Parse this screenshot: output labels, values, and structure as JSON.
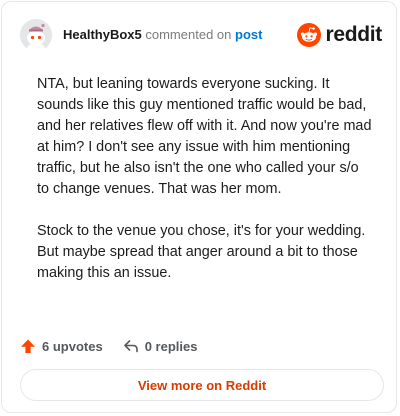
{
  "header": {
    "username": "HealthyBox5",
    "action_text": "commented on",
    "target_link": "post",
    "brand_name": "reddit",
    "brand_color": "#ff4500"
  },
  "comment": {
    "paragraphs": [
      "NTA, but leaning towards everyone sucking. It sounds like this guy mentioned traffic would be bad, and her relatives flew off with it. And now you're mad at him? I don't see any issue with him mentioning traffic, but he also isn't the one who called your s/o to change venues. That was her mom.",
      "Stock to the venue you chose, it's for your wedding. But maybe spread that anger around a bit to those making this an issue."
    ]
  },
  "actions": {
    "upvote_icon": "upvote-arrow-icon",
    "upvotes_label": "6 upvotes",
    "reply_icon": "reply-arrow-icon",
    "replies_label": "0 replies"
  },
  "footer": {
    "view_more_label": "View more on Reddit"
  }
}
